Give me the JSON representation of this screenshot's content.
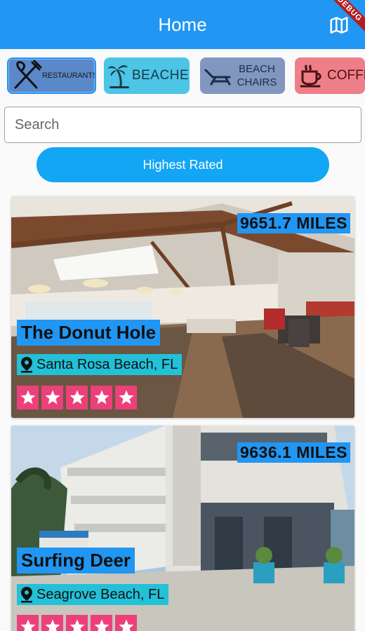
{
  "app_bar": {
    "title": "Home",
    "debug_banner": "DEBUG",
    "map_icon": "map-icon"
  },
  "categories": [
    {
      "label": "RESTAURANTS",
      "icon": "utensils-icon",
      "color": "#5b88c9",
      "selected": true
    },
    {
      "label": "BEACHES",
      "icon": "palm-tree-icon",
      "color": "#4cc5e6",
      "selected": false
    },
    {
      "label": "BEACH CHAIRS",
      "icon": "beach-chair-icon",
      "color": "#8197bf",
      "selected": false
    },
    {
      "label": "COFFEE",
      "icon": "coffee-cup-icon",
      "color": "#ee7e87",
      "selected": false
    }
  ],
  "search": {
    "placeholder": "Search",
    "value": ""
  },
  "sort_button": {
    "label": "Highest Rated"
  },
  "places": [
    {
      "name": "The Donut Hole",
      "location": "Santa Rosa Beach, FL",
      "distance": "9651.7 MILES",
      "rating": 5
    },
    {
      "name": "Surfing Deer",
      "location": "Seagrove Beach, FL",
      "distance": "9636.1 MILES",
      "rating": 5
    }
  ],
  "colors": {
    "primary": "#2196f3",
    "location_badge": "#22c1d8",
    "star_badge": "#ec407a",
    "sort_button": "#13a6f4"
  }
}
